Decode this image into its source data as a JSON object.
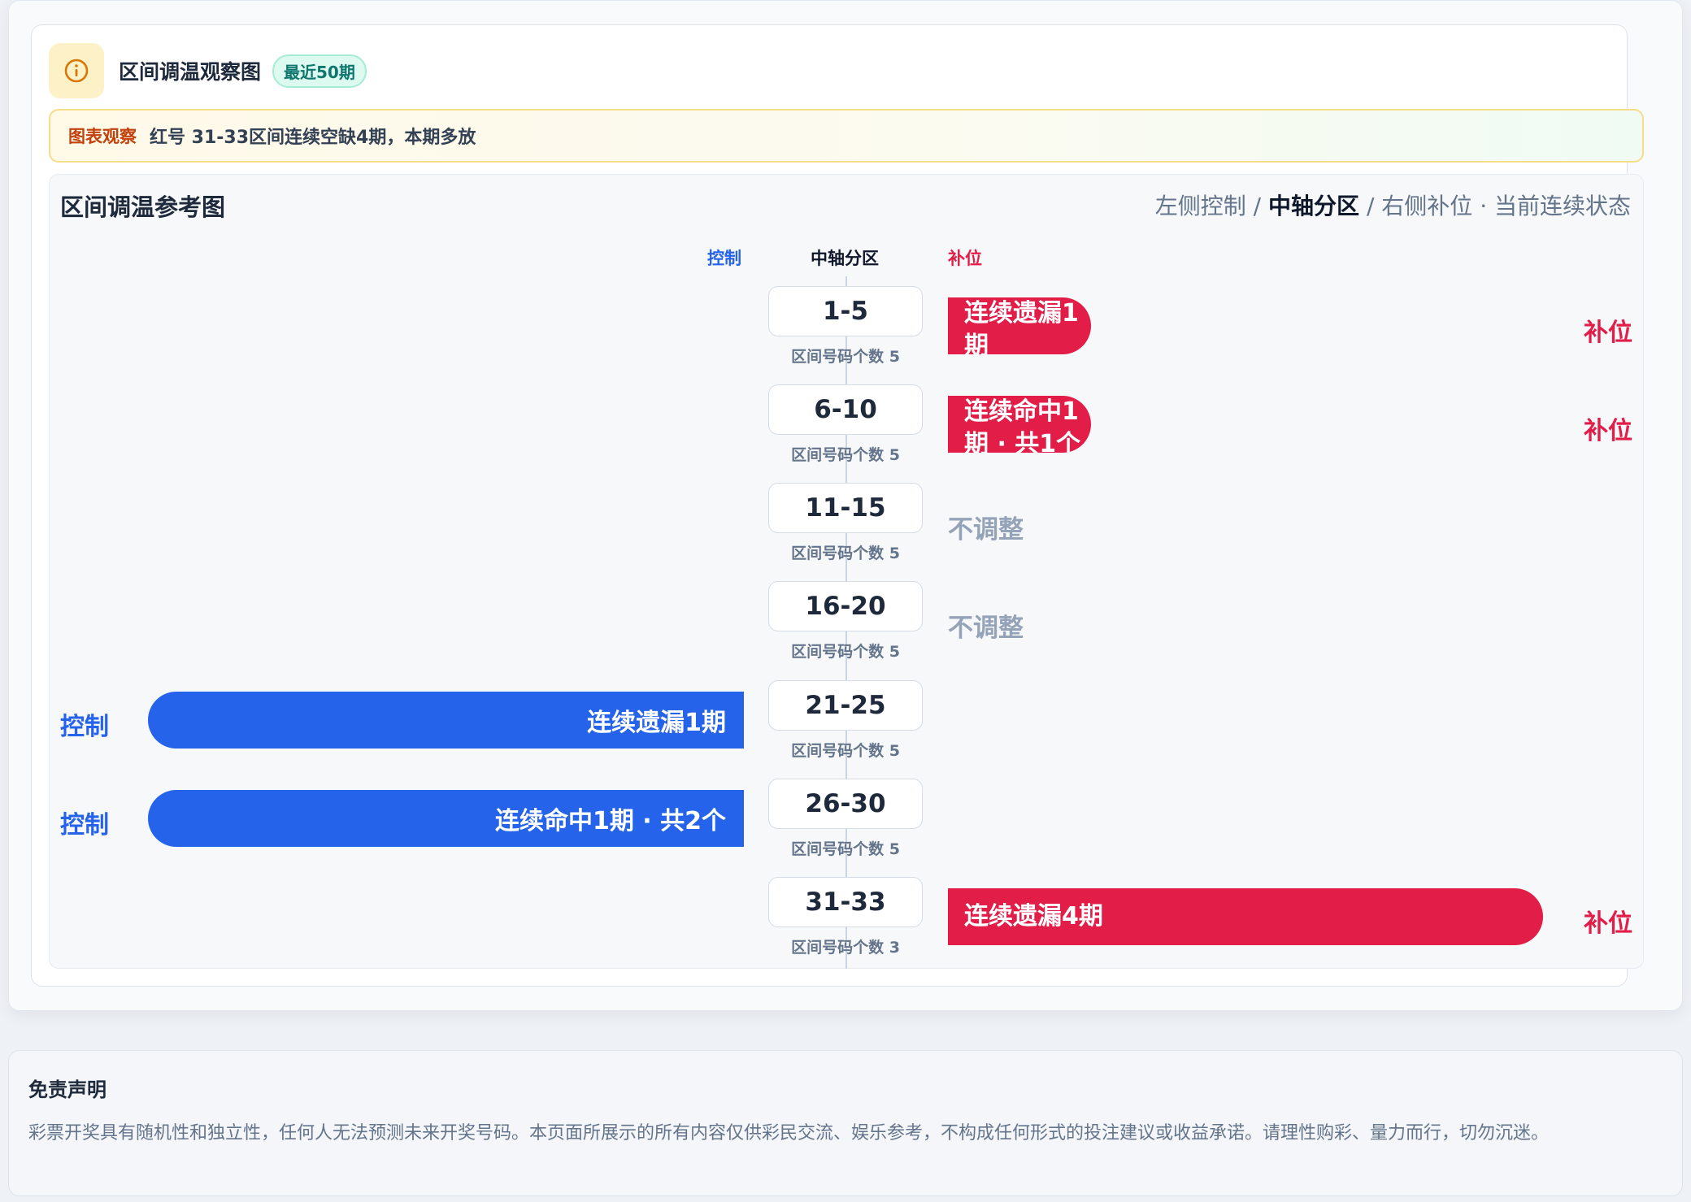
{
  "header": {
    "title": "区间调温观察图",
    "period_badge": "最近50期"
  },
  "observation": {
    "label": "图表观察",
    "text": "红号 31-33区间连续空缺4期，本期多放"
  },
  "chart": {
    "title": "区间调温参考图",
    "legend": {
      "left": "左侧控制 /",
      "center": "中轴分区",
      "right": "/ 右侧补位 · 当前连续状态"
    },
    "columns": {
      "left": "控制",
      "center": "中轴分区",
      "right": "补位"
    }
  },
  "rows": [
    {
      "range": "1-5",
      "count": "区间号码个数 5",
      "bar_text": "连续遗漏1期",
      "side": "补位"
    },
    {
      "range": "6-10",
      "count": "区间号码个数 5",
      "bar_text": "连续命中1期 · 共1个",
      "side": "补位"
    },
    {
      "range": "11-15",
      "count": "区间号码个数 5",
      "status": "不调整"
    },
    {
      "range": "16-20",
      "count": "区间号码个数 5",
      "status": "不调整"
    },
    {
      "range": "21-25",
      "count": "区间号码个数 5",
      "bar_text": "连续遗漏1期",
      "side": "控制"
    },
    {
      "range": "26-30",
      "count": "区间号码个数 5",
      "bar_text": "连续命中1期 · 共2个",
      "side": "控制"
    },
    {
      "range": "31-33",
      "count": "区间号码个数 3",
      "bar_text": "连续遗漏4期",
      "side": "补位"
    }
  ],
  "disclaimer": {
    "title": "免责声明",
    "text": "彩票开奖具有随机性和独立性，任何人无法预测未来开奖号码。本页面所展示的所有内容仅供彩民交流、娱乐参考，不构成任何形式的投注建议或收益承诺。请理性购彩、量力而行，切勿沉迷。"
  },
  "colors": {
    "control": "#2563eb",
    "supplement": "#e11d48",
    "neutral": "#94a3b8"
  }
}
